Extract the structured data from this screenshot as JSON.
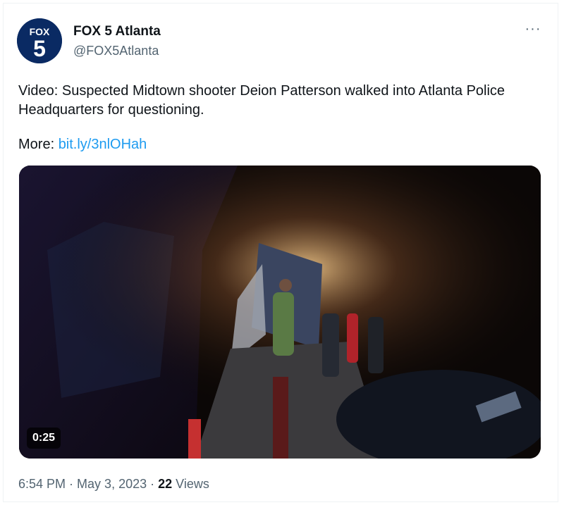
{
  "tweet": {
    "author_name": "FOX 5 Atlanta",
    "author_handle": "@FOX5Atlanta",
    "avatar_logo_text": [
      "FOX",
      "5"
    ],
    "more_label": "···",
    "text": "Video: Suspected Midtown shooter Deion Patterson walked into Atlanta Police Headquarters for questioning.",
    "more_prefix": "More: ",
    "more_link": "bit.ly/3nlOHah",
    "video_duration": "0:25",
    "time": "6:54 PM",
    "sep1": " · ",
    "date": "May 3, 2023",
    "sep2": " · ",
    "views_count": "22",
    "views_label": " Views"
  },
  "colors": {
    "link": "#1d9bf0",
    "secondary_text": "#536471",
    "avatar_bg": "#0a2a63"
  },
  "icons": {
    "avatar": "fox5-logo-icon",
    "more": "more-dots-icon"
  }
}
